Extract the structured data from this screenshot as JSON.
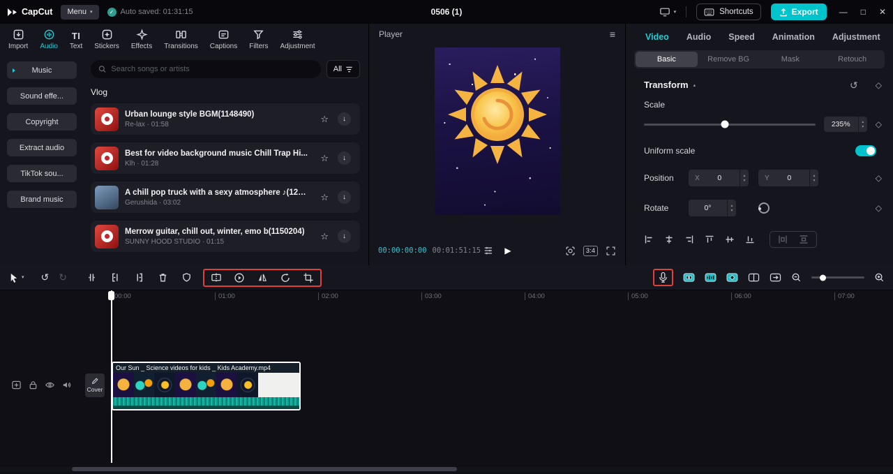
{
  "colors": {
    "accent": "#00c4cc",
    "tab_active": "#2bc8d2",
    "highlight_box": "#e0403a",
    "timecode": "#35c3cf"
  },
  "glyphs": {
    "caret_down": "▾",
    "check": "✓",
    "hamburger": "≡",
    "play": "▶",
    "star": "☆",
    "download": "↓",
    "diamond": "◇",
    "reset": "↺",
    "undo": "↺",
    "redo": "↻",
    "step_up": "▴",
    "step_down": "▾",
    "collapse": "▴",
    "minimize": "—",
    "maximize": "□",
    "close": "✕"
  },
  "topbar": {
    "logo": "CapCut",
    "menu": "Menu",
    "autosave": "Auto saved: 01:31:15",
    "title": "0506 (1)",
    "shortcuts": "Shortcuts",
    "export": "Export"
  },
  "media_tools": {
    "text_icon": "TI",
    "items": [
      {
        "label": "Import"
      },
      {
        "label": "Audio"
      },
      {
        "label": "Text"
      },
      {
        "label": "Stickers"
      },
      {
        "label": "Effects"
      },
      {
        "label": "Transitions"
      },
      {
        "label": "Captions"
      },
      {
        "label": "Filters"
      },
      {
        "label": "Adjustment"
      }
    ]
  },
  "sidebar": {
    "items": [
      "Music",
      "Sound effe...",
      "Copyright",
      "Extract audio",
      "TikTok sou...",
      "Brand music"
    ]
  },
  "library": {
    "search_placeholder": "Search songs or artists",
    "filter_label": "All",
    "section": "Vlog",
    "songs": [
      {
        "title": "Urban lounge style BGM(1148490)",
        "meta": "Re-lax · 01:58",
        "art": "linear-gradient(135deg,#e0483f,#8f1010)"
      },
      {
        "title": "Best for video background music Chill Trap Hi...",
        "meta": "Klh · 01:28",
        "art": "linear-gradient(135deg,#e0483f,#8f1010)"
      },
      {
        "title": "A chill pop truck with a sexy atmosphere ♪(128...",
        "meta": "Gerushida · 03:02",
        "art": "linear-gradient(150deg,#7d9cbd,#33475e)"
      },
      {
        "title": "Merrow guitar, chill out, winter, emo b(1150204)",
        "meta": "SUNNY HOOD STUDIO · 01:15",
        "art": "linear-gradient(135deg,#e0483f,#8f1010)"
      }
    ]
  },
  "player": {
    "title": "Player",
    "current": "00:00:00:00",
    "duration": "00:01:51:15",
    "ratio": "3:4"
  },
  "inspector": {
    "tabs": [
      "Video",
      "Audio",
      "Speed",
      "Animation",
      "Adjustment"
    ],
    "subtabs": [
      "Basic",
      "Remove BG",
      "Mask",
      "Retouch"
    ],
    "transform_label": "Transform",
    "scale_label": "Scale",
    "scale_value": "235%",
    "uniform_label": "Uniform scale",
    "position_label": "Position",
    "x_label": "X",
    "x_value": "0",
    "y_label": "Y",
    "y_value": "0",
    "rotate_label": "Rotate",
    "rotate_value": "0°"
  },
  "timeline": {
    "ruler": [
      "00:00",
      "01:00",
      "02:00",
      "03:00",
      "04:00",
      "05:00",
      "06:00",
      "07:00"
    ],
    "cover_label": "Cover",
    "clip_title": "Our Sun _ Science videos for kids _ Kids Academy.mp4"
  }
}
